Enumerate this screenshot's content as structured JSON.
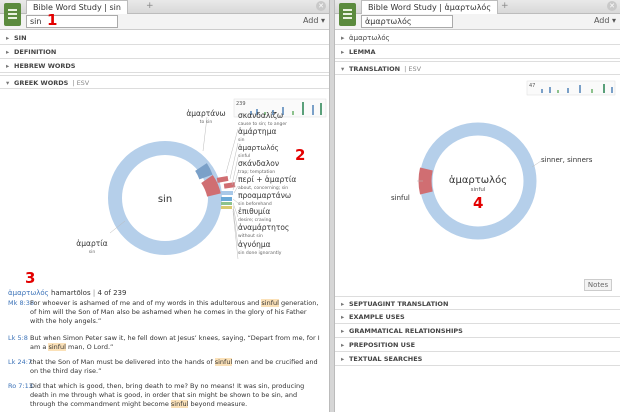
{
  "left": {
    "tab_title": "Bible Word Study | sin",
    "search_value": "sin",
    "add_label": "Add",
    "sections": [
      "SIN",
      "DEFINITION",
      "HEBREW WORDS"
    ],
    "greek_section": "GREEK WORDS",
    "greek_version": "ESV",
    "center_label": "sin",
    "count_label": "239",
    "words": [
      {
        "word": "ἁμαρτάνω",
        "gloss": "to sin"
      },
      {
        "word": "σκανδαλίζω",
        "gloss": "cause to sin; to anger"
      },
      {
        "word": "ἁμάρτημα",
        "gloss": "sin"
      },
      {
        "word": "ἁμαρτωλός",
        "gloss": "sinful"
      },
      {
        "word": "σκάνδαλον",
        "gloss": "trap; temptation"
      },
      {
        "word": "περί + ἁμαρτία",
        "gloss": "about, concerning; sin"
      },
      {
        "word": "προαμαρτάνω",
        "gloss": "sin beforehand"
      },
      {
        "word": "ἐπιθυμία",
        "gloss": "desire; craving"
      },
      {
        "word": "ἀναμάρτητος",
        "gloss": "without sin"
      },
      {
        "word": "ἀγνόημα",
        "gloss": "sin done ignorantly"
      },
      {
        "word": "ἁμαρτία",
        "gloss": "sin"
      }
    ],
    "selection_word": "ἁμαρτωλός",
    "selection_translit": "hamartōlos",
    "selection_count": "4 of 239",
    "passages": [
      {
        "ref": "Mk 8:38",
        "pre": "For whoever is ashamed of me and of my words in this adulterous and ",
        "hit": "sinful",
        "post": " generation, of him will the Son of Man also be ashamed when he comes in the glory of his Father with the holy angels.”"
      },
      {
        "ref": "Lk 5:8",
        "pre": "But when Simon Peter saw it, he fell down at Jesus’ knees, saying, “Depart from me, for I am a ",
        "hit": "sinful",
        "post": " man, O Lord.”"
      },
      {
        "ref": "Lk 24:7",
        "pre": "that the Son of Man must be delivered into the hands of ",
        "hit": "sinful",
        "post": " men and be crucified and on the third day rise.”"
      },
      {
        "ref": "Ro 7:13",
        "pre": "Did that which is good, then, bring death to me? By no means! It was sin, producing death in me through what is good, in order that sin might be shown to be sin, and through the commandment might become ",
        "hit": "sinful",
        "post": " beyond measure."
      }
    ]
  },
  "right": {
    "tab_title": "Bible Word Study | ἁμαρτωλός",
    "search_value": "ἁμαρτωλός",
    "add_label": "Add",
    "sections_top": [
      "ἁμαρτωλός",
      "LEMMA"
    ],
    "translation_section": "TRANSLATION",
    "translation_version": "ESV",
    "count_label": "47",
    "center_word": "ἁμαρτωλός",
    "center_gloss": "sinful",
    "label_right": "sinner, sinners",
    "label_left": "sinful",
    "notes_label": "Notes",
    "sections_bottom": [
      "SEPTUAGINT TRANSLATION",
      "EXAMPLE USES",
      "GRAMMATICAL RELATIONSHIPS",
      "PREPOSITION USE",
      "TEXTUAL SEARCHES"
    ]
  },
  "markers": [
    "1",
    "2",
    "3",
    "4"
  ],
  "colors": {
    "ring": "#b5cfea",
    "highlight": "#d06e72",
    "accent_green": "#5b8b3e",
    "link": "#3b72b8"
  }
}
